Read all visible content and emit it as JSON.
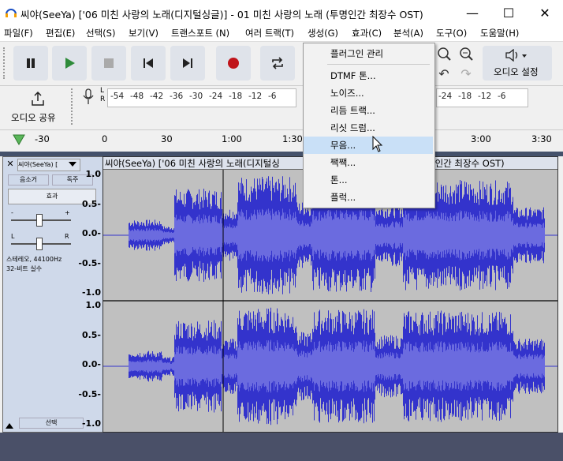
{
  "window": {
    "title": "씨야(SeeYa) ['06 미친 사랑의 노래(디지털싱글)] - 01 미친 사랑의 노래 (투명인간 최장수 OST)",
    "min_glyph": "—",
    "max_glyph": "☐",
    "close_glyph": "✕"
  },
  "menu": {
    "file": "파일(F)",
    "edit": "편집(E)",
    "select": "선택(S)",
    "view": "보기(V)",
    "transport": "트랜스포트 (N)",
    "tracks": "여러 트랙(T)",
    "generate": "생성(G)",
    "effect": "효과(C)",
    "analyze": "분석(A)",
    "tools": "도구(O)",
    "help": "도움말(H)"
  },
  "toolbar": {
    "audio_setup": "오디오 설정",
    "audio_share": "오디오 공유"
  },
  "meters": {
    "rec_lr": "L\nR",
    "scale": [
      "-54",
      "-48",
      "-42",
      "-36",
      "-30",
      "-24",
      "-18",
      "-12",
      "-6"
    ],
    "play_scale": [
      "-24",
      "-18",
      "-12",
      "-6"
    ]
  },
  "ruler": {
    "labels": [
      "-30",
      "0",
      "30",
      "1:00",
      "1:30",
      "3:00",
      "3:30"
    ]
  },
  "track": {
    "name": "씨야(SeeYa) [",
    "mute": "음소거",
    "solo": "독주",
    "effects": "효과",
    "gain_minus": "-",
    "gain_plus": "+",
    "pan_l": "L",
    "pan_r": "R",
    "info": "스테레오, 44100Hz\n32-비트 실수",
    "select": "선택",
    "clip_title_left": "씨야(SeeYa) ['06 미친 사랑의 노래(디지털싱",
    "clip_title_right": "명인간 최장수 OST)"
  },
  "axis": {
    "labels": [
      "1.0",
      "0.5-",
      "0.0-",
      "-0.5-",
      "-1.0"
    ]
  },
  "generate_menu": {
    "items": [
      "플러그인 관리",
      "DTMF 톤...",
      "노이즈...",
      "리듬 트랙...",
      "리싯 드럼...",
      "무음...",
      "짹짹...",
      "톤...",
      "플럭..."
    ],
    "highlighted_index": 5,
    "highlight_color": "#c9e0f7"
  },
  "colors": {
    "waveform": "#3333cc",
    "waveform_rms": "#6b6bdf",
    "highlight_box": "#e00000"
  }
}
